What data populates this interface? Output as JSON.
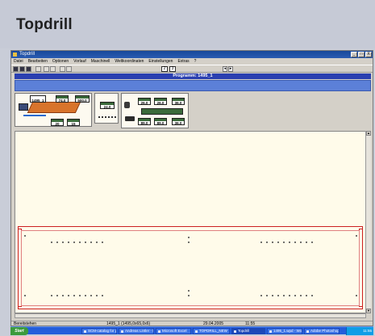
{
  "banner": {
    "title": "Topdrill"
  },
  "window": {
    "title": "Topdrill",
    "controls": [
      "_",
      "□",
      "X"
    ],
    "menu": [
      "Datei",
      "Bearbeiten",
      "Optionen",
      "Vorlauf",
      "Maschinell",
      "Weltkoordinaten",
      "Einstellungen",
      "Extras",
      "?"
    ],
    "page_number": "2",
    "page_total": "3",
    "nav_prev": "◂",
    "nav_next": "▸"
  },
  "program": {
    "label": "Programm: 1495_1"
  },
  "panel1": {
    "values": [
      "1495_1",
      "74.0",
      "500.0",
      "20",
      "15"
    ]
  },
  "panel2": {
    "values": [
      "24.0"
    ]
  },
  "panel3": {
    "values": [
      "26.0",
      "26.0",
      "36.0",
      "89.0",
      "89.0",
      "36.0"
    ]
  },
  "statusbar": {
    "left": "Bereitstehen",
    "center": "1495_1 (1495,0x65,0x6)",
    "date": "29.04.2005",
    "time": "11:55"
  },
  "taskbar": {
    "start_label": "Start",
    "items": [
      {
        "label": "SCM-catalog for p..."
      },
      {
        "label": "Andreas Lintler - E..."
      },
      {
        "label": "Microsoft Excel"
      },
      {
        "label": "TOPDRILL_NEW"
      },
      {
        "label": "Topdrill"
      },
      {
        "label": "1495_1.wpd - Wor..."
      },
      {
        "label": "Adobe Photoshop"
      }
    ],
    "clock": "11:55"
  },
  "colors": {
    "title_bar": "#18489a",
    "program_bar": "#2a3fb0",
    "board_outline": "#cc2020",
    "taskbar": "#245edb"
  }
}
